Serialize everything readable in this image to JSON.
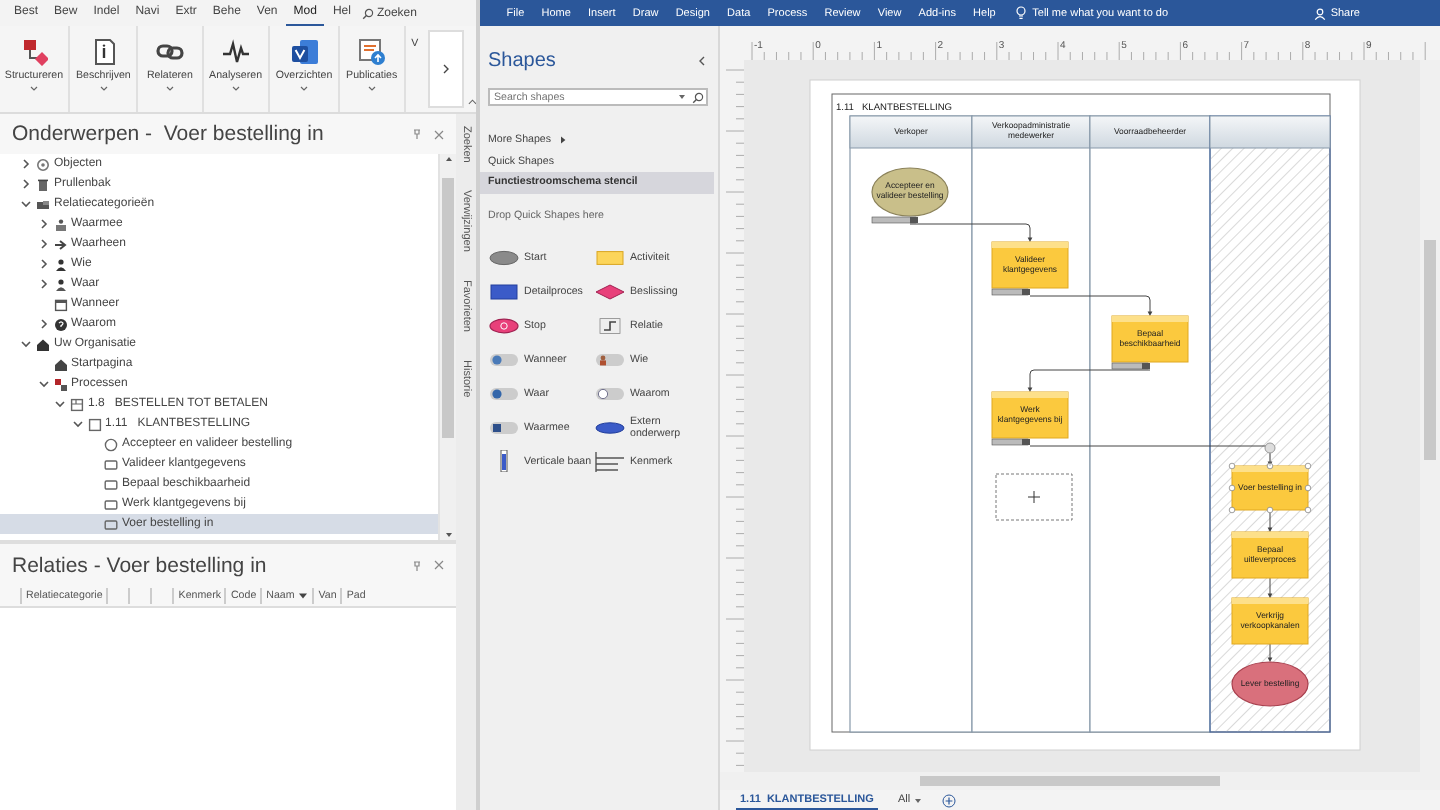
{
  "left_menu": [
    {
      "label": "Best",
      "selected": false
    },
    {
      "label": "Bew",
      "selected": false
    },
    {
      "label": "Indel",
      "selected": false
    },
    {
      "label": "Navi",
      "selected": false
    },
    {
      "label": "Extr",
      "selected": false
    },
    {
      "label": "Behe",
      "selected": false
    },
    {
      "label": "Ven",
      "selected": false
    },
    {
      "label": "Mod",
      "selected": true
    },
    {
      "label": "Hel",
      "selected": false
    }
  ],
  "search_label": "Zoeken",
  "ribbon": [
    {
      "label": "Structureren",
      "kind": "structure"
    },
    {
      "label": "Beschrijven",
      "kind": "describe"
    },
    {
      "label": "Relateren",
      "kind": "relate"
    },
    {
      "label": "Analyseren",
      "kind": "analyse"
    },
    {
      "label": "Overzichten",
      "kind": "overview"
    },
    {
      "label": "Publicaties",
      "kind": "publish"
    },
    {
      "label": "V",
      "kind": "cut"
    }
  ],
  "topics": {
    "title": "Onderwerpen -  Voer bestelling in",
    "tree": [
      {
        "label": "Objecten",
        "kind": "objects",
        "expandable": true,
        "expanded": false,
        "selected": false
      },
      {
        "label": "Prullenbak",
        "kind": "trash",
        "expandable": true,
        "expanded": false,
        "selected": false
      },
      {
        "label": "Relatiecategorieën",
        "kind": "categories",
        "expandable": true,
        "expanded": true,
        "selected": false,
        "children": [
          {
            "label": "Waarmee",
            "kind": "with_what",
            "expandable": true,
            "expanded": false,
            "selected": false
          },
          {
            "label": "Waarheen",
            "kind": "where_to",
            "expandable": true,
            "expanded": false,
            "selected": false
          },
          {
            "label": "Wie",
            "kind": "who",
            "expandable": true,
            "expanded": false,
            "selected": false
          },
          {
            "label": "Waar",
            "kind": "where",
            "expandable": true,
            "expanded": false,
            "selected": false
          },
          {
            "label": "Wanneer",
            "kind": "when",
            "expandable": false,
            "expanded": false,
            "selected": false
          },
          {
            "label": "Waarom",
            "kind": "why",
            "expandable": true,
            "expanded": false,
            "selected": false
          }
        ]
      },
      {
        "label": "Uw Organisatie",
        "kind": "organisation",
        "expandable": true,
        "expanded": true,
        "selected": false,
        "children": [
          {
            "label": "Startpagina",
            "kind": "page",
            "expandable": false,
            "expanded": false,
            "selected": false
          },
          {
            "label": "Processen",
            "kind": "processes",
            "expandable": true,
            "expanded": true,
            "selected": false,
            "children": [
              {
                "label": "1.8   BESTELLEN TOT BETALEN",
                "kind": "process_group",
                "expandable": true,
                "expanded": true,
                "selected": false,
                "children": [
                  {
                    "label": "1.11   KLANTBESTELLING",
                    "kind": "process",
                    "expandable": true,
                    "expanded": true,
                    "selected": false,
                    "children": [
                      {
                        "label": "Accepteer en valideer bestelling",
                        "kind": "event",
                        "expandable": false,
                        "expanded": false,
                        "selected": false
                      },
                      {
                        "label": "Valideer klantgegevens",
                        "kind": "activity",
                        "expandable": false,
                        "expanded": false,
                        "selected": false
                      },
                      {
                        "label": "Bepaal beschikbaarheid",
                        "kind": "activity",
                        "expandable": false,
                        "expanded": false,
                        "selected": false
                      },
                      {
                        "label": "Werk klantgegevens bij",
                        "kind": "activity",
                        "expandable": false,
                        "expanded": false,
                        "selected": false
                      },
                      {
                        "label": "Voer bestelling in",
                        "kind": "activity",
                        "expandable": false,
                        "expanded": false,
                        "selected": true
                      }
                    ]
                  }
                ]
              }
            ]
          }
        ]
      }
    ]
  },
  "side_tabs": [
    {
      "label": "Zoeken",
      "selected": false
    },
    {
      "label": "Verwijzingen",
      "selected": false
    },
    {
      "label": "Favorieten",
      "selected": false
    },
    {
      "label": "Historie",
      "selected": false
    }
  ],
  "relations": {
    "title": "Relaties - Voer bestelling in",
    "columns": [
      {
        "label": "Relatiecategorie",
        "sorted": false
      },
      {
        "sorted": false
      },
      {
        "sorted": false
      },
      {
        "sorted": false
      },
      {
        "label": "Kenmerk",
        "sorted": false
      },
      {
        "label": "Code",
        "sorted": false
      },
      {
        "label": "Naam",
        "sorted": true
      },
      {
        "label": "Van",
        "sorted": false
      },
      {
        "label": "Pad",
        "sorted": false
      }
    ]
  },
  "visio_menu": [
    {
      "label": "File"
    },
    {
      "label": "Home"
    },
    {
      "label": "Insert"
    },
    {
      "label": "Draw"
    },
    {
      "label": "Design"
    },
    {
      "label": "Data"
    },
    {
      "label": "Process"
    },
    {
      "label": "Review"
    },
    {
      "label": "View"
    },
    {
      "label": "Add-ins"
    },
    {
      "label": "Help"
    }
  ],
  "tell_me": "Tell me what you want to do",
  "share": "Share",
  "shapes_pane": {
    "title": "Shapes",
    "search": {
      "placeholder": "Search shapes"
    },
    "nav": [
      {
        "label": "More Shapes",
        "kind": "submenu",
        "selected": false
      },
      {
        "label": "Quick Shapes",
        "kind": "link",
        "selected": false
      },
      {
        "label": "Functiestroomschema stencil",
        "kind": "link",
        "selected": true
      }
    ],
    "drop_hint": "Drop Quick Shapes here",
    "shapes": [
      {
        "label": "Start",
        "kind": "start"
      },
      {
        "label": "Activiteit",
        "kind": "activity"
      },
      {
        "label": "Detailproces",
        "kind": "subprocess"
      },
      {
        "label": "Beslissing",
        "kind": "decision"
      },
      {
        "label": "Stop",
        "kind": "stop"
      },
      {
        "label": "Relatie",
        "kind": "relation"
      },
      {
        "label": "Wanneer",
        "kind": "when"
      },
      {
        "label": "Wie",
        "kind": "who"
      },
      {
        "label": "Waar",
        "kind": "where"
      },
      {
        "label": "Waarom",
        "kind": "why"
      },
      {
        "label": "Waarmee",
        "kind": "with_what"
      },
      {
        "label": "Extern onderwerp",
        "kind": "external"
      },
      {
        "label": "Verticale baan",
        "kind": "lane"
      },
      {
        "label": "Kenmerk",
        "kind": "feature"
      }
    ]
  },
  "ruler": [
    "-1",
    "0",
    "1",
    "2",
    "3",
    "4",
    "5",
    "6",
    "7",
    "8",
    "9"
  ],
  "diagram": {
    "title": "1.11   KLANTBESTELLING",
    "lanes": [
      {
        "label": "Verkoper",
        "hatched": false
      },
      {
        "label": "Verkoopadministratie medewerker",
        "hatched": false
      },
      {
        "label": "Voorraadbeheerder",
        "hatched": false
      },
      {
        "hatched": true
      }
    ],
    "shapes": [
      {
        "label": "Accepteer en valideer bestelling",
        "kind": "event",
        "tagged": true,
        "selected": false
      },
      {
        "label": "Valideer klantgegevens",
        "kind": "activity",
        "tagged": true,
        "selected": false
      },
      {
        "label": "Bepaal beschikbaarheid",
        "kind": "activity",
        "tagged": true,
        "selected": false
      },
      {
        "label": "Werk klantgegevens bij",
        "kind": "activity",
        "tagged": true,
        "selected": false
      },
      {
        "kind": "drop_target",
        "tagged": false,
        "selected": false
      },
      {
        "label": "Voer bestelling in",
        "kind": "activity",
        "tagged": false,
        "selected": true
      },
      {
        "label": "Bepaal uitleverproces",
        "kind": "activity",
        "tagged": false,
        "selected": false
      },
      {
        "label": "Verkrijg verkoopkanalen",
        "kind": "activity",
        "tagged": false,
        "selected": false
      },
      {
        "label": "Lever bestelling",
        "kind": "end",
        "tagged": false,
        "selected": false
      }
    ]
  },
  "page_tabs": [
    {
      "label": "1.11  KLANTBESTELLING",
      "selected": true
    },
    {
      "label": "All",
      "selected": false
    }
  ]
}
